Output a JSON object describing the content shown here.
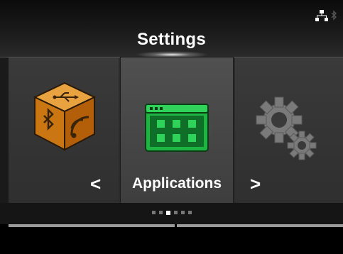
{
  "header": {
    "title": "Settings",
    "status_icons": [
      "network-icon",
      "bluetooth-icon"
    ]
  },
  "carousel": {
    "items": [
      {
        "name": "interface",
        "icon": "interface-cube-icon"
      },
      {
        "name": "applications",
        "icon": "applications-icon",
        "label": "Applications",
        "selected": true
      },
      {
        "name": "system",
        "icon": "gears-icon"
      }
    ],
    "prev_arrow": "<",
    "next_arrow": ">"
  },
  "page_indicator": {
    "total": 6,
    "current": 2
  },
  "colors": {
    "accent_green": "#22c34a",
    "interface_orange": "#e08a1c",
    "background": "#2b2b2b"
  }
}
